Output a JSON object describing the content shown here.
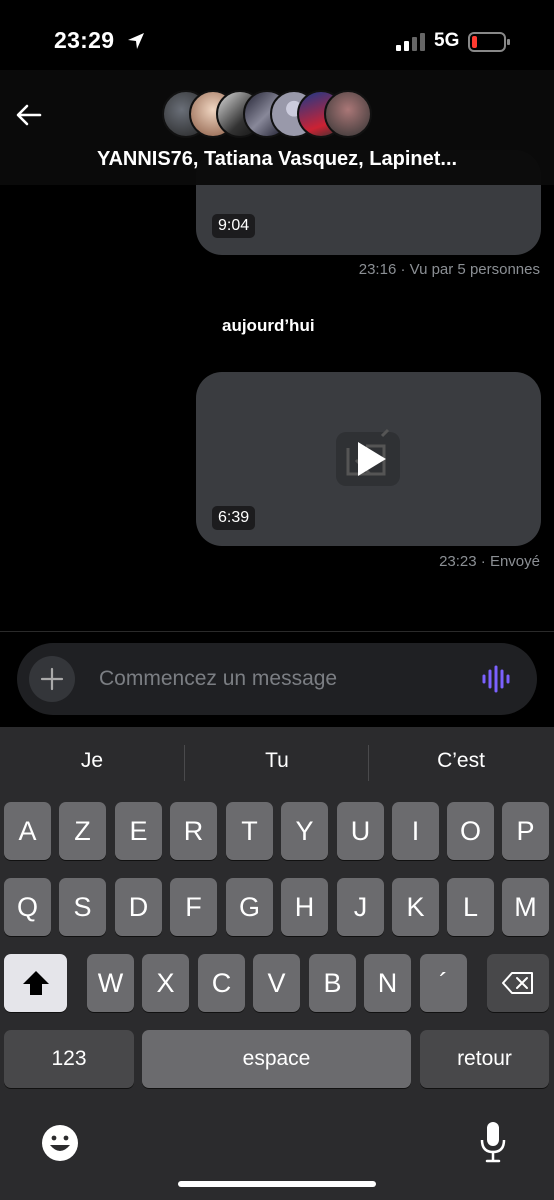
{
  "status": {
    "time": "23:29",
    "network": "5G"
  },
  "conversation": {
    "title": "YANNIS76, Tatiana Vasquez, Lapinet..."
  },
  "messages": [
    {
      "duration": "9:04",
      "time": "23:16",
      "status": "· Vu par 5 personnes"
    },
    {
      "duration": "6:39",
      "time": "23:23",
      "status": "· Envoyé"
    }
  ],
  "day_separator": "aujourd’hui",
  "composer": {
    "placeholder": "Commencez un message"
  },
  "keyboard": {
    "suggestions": [
      "Je",
      "Tu",
      "C’est"
    ],
    "row1": [
      "A",
      "Z",
      "E",
      "R",
      "T",
      "Y",
      "U",
      "I",
      "O",
      "P"
    ],
    "row2": [
      "Q",
      "S",
      "D",
      "F",
      "G",
      "H",
      "J",
      "K",
      "L",
      "M"
    ],
    "row3": [
      "W",
      "X",
      "C",
      "V",
      "B",
      "N",
      "´"
    ],
    "numbers_label": "123",
    "space_label": "espace",
    "return_label": "retour"
  },
  "colors": {
    "background": "#000000",
    "bubble": "#3a3c40",
    "accent": "#7b61ff",
    "battery_low": "#ff3b30"
  }
}
